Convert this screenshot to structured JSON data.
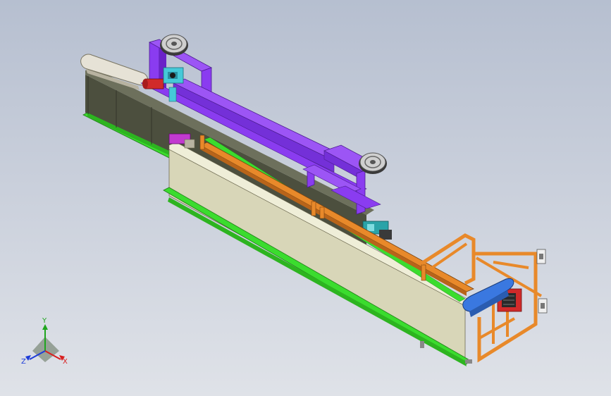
{
  "triad": {
    "x_label": "X",
    "y_label": "Y",
    "z_label": "Z",
    "x_color": "#d81e1e",
    "y_color": "#1ea51e",
    "z_color": "#1e3cd8"
  },
  "colors": {
    "background_top": "#b6bfd0",
    "background_bottom": "#dfe2e8",
    "purple_frame": "#8a3cf0",
    "orange_frame": "#e8892a",
    "green_rail": "#3bdc2e",
    "beige_panel": "#d8d6b8",
    "dark_beam": "#4c4f3e",
    "blue_guard": "#3a78e0",
    "white_guard": "#e6e2d6",
    "red_motor": "#d12a2a",
    "cyan_part": "#45c9d8",
    "teal_part": "#2aa3a8",
    "magenta_part": "#c23ad0",
    "wheel": "#cfcfcf"
  }
}
